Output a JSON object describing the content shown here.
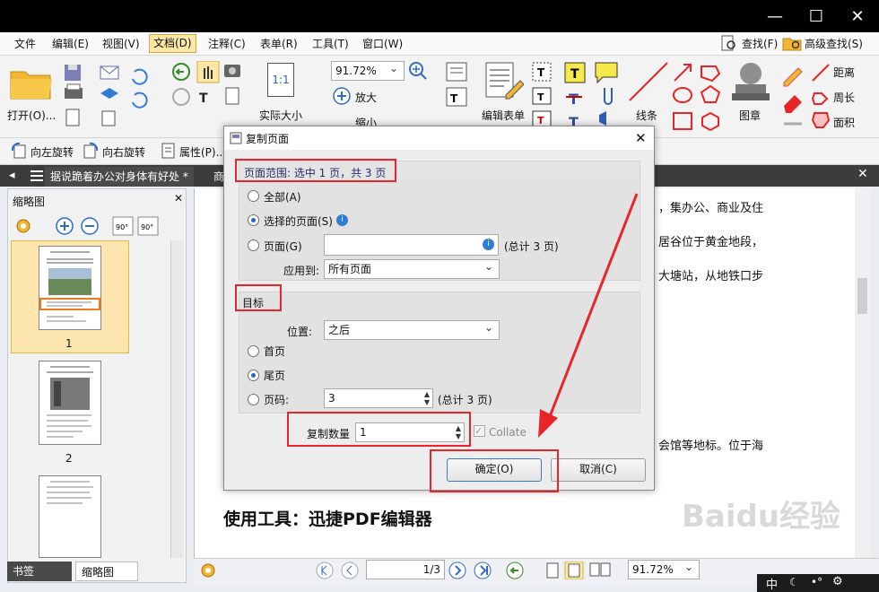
{
  "window": {
    "min": "—",
    "max": "☐",
    "close": "✕"
  },
  "menu": {
    "items": [
      "文件",
      "编辑(E)",
      "视图(V)",
      "文档(D)",
      "注释(C)",
      "表单(R)",
      "工具(T)",
      "窗口(W)"
    ],
    "right": [
      "查找(F)",
      "高级查找(S)"
    ]
  },
  "ribbon": {
    "open": "打开(O)...",
    "zoom": "91.72%",
    "actual_size": "实际大小",
    "fit_label": "1:1",
    "zoom_in": "放大",
    "zoom_out": "缩小",
    "edit_form": "编辑表单",
    "lines": "线条",
    "stamp": "图章",
    "measure": [
      "距离",
      "周长",
      "面积"
    ]
  },
  "toolbar2": {
    "rotate_left": "向左旋转",
    "rotate_right": "向右旋转",
    "properties": "属性(P)..."
  },
  "doc_tabs": [
    "据说跪着办公对身体有好处 *",
    "商"
  ],
  "left_panel": {
    "title": "缩略图",
    "pages": [
      "1",
      "2"
    ],
    "tabs": [
      "书签",
      "缩略图"
    ],
    "rotate": "90°"
  },
  "doc_text": {
    "line1": "，集办公、商业及住",
    "line2": "居谷位于黄金地段，",
    "line3": "大塘站，从地铁口步",
    "line4": "会馆等地标。位于海",
    "heading": "使用工具：迅捷PDF编辑器"
  },
  "status": {
    "page": "1/3",
    "zoom": "91.72%"
  },
  "taskbar": {
    "ime": "中"
  },
  "watermark": "Baidu经验",
  "dialog": {
    "title": "复制页面",
    "range_header": "页面范围: 选中 1 页，共 3 页",
    "opt_all": "全部(A)",
    "opt_selected": "选择的页面(S)",
    "opt_pages": "页面(G)",
    "pages_value": "",
    "pages_total": "(总计 3 页)",
    "apply_label": "应用到:",
    "apply_value": "所有页面",
    "target_header": "目标",
    "position_label": "位置:",
    "position_value": "之后",
    "opt_first": "首页",
    "opt_last": "尾页",
    "opt_pageno": "页码:",
    "pageno_value": "3",
    "pageno_total": "(总计 3 页)",
    "copies_label": "复制数量",
    "copies_value": "1",
    "collate": "Collate",
    "ok": "确定(O)",
    "cancel": "取消(C)"
  },
  "colors": {
    "accent": "#2166c9",
    "highlight": "#e8262a",
    "folder": "#f2b632"
  }
}
